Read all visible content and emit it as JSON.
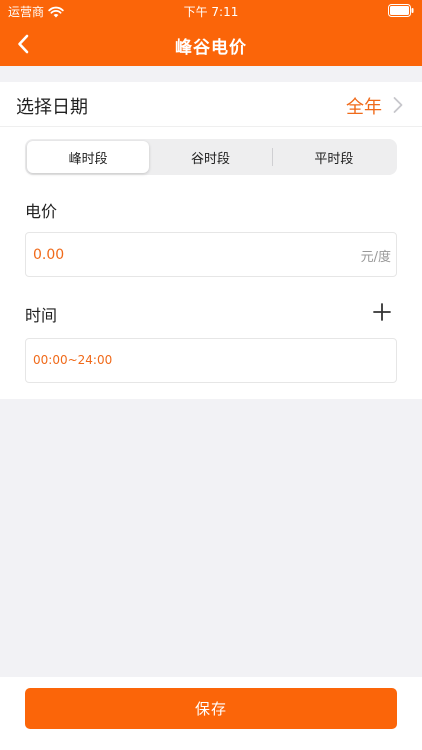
{
  "status_bar": {
    "carrier": "运营商",
    "time": "下午 7:11"
  },
  "nav": {
    "title": "峰谷电价",
    "back_icon": "chevron-left-icon"
  },
  "date_row": {
    "label": "选择日期",
    "value": "全年"
  },
  "period_tabs": {
    "items": [
      "峰时段",
      "谷时段",
      "平时段"
    ],
    "selected": "峰时段"
  },
  "price": {
    "label": "电价",
    "value": "0.00",
    "unit": "元/度"
  },
  "time": {
    "label": "时间",
    "add_icon": "plus-icon",
    "range": "00:00~24:00"
  },
  "footer": {
    "save_label": "保存"
  },
  "colors": {
    "accent": "#fb6509",
    "accent_text": "#f06a1a",
    "background": "#f2f2f5"
  }
}
